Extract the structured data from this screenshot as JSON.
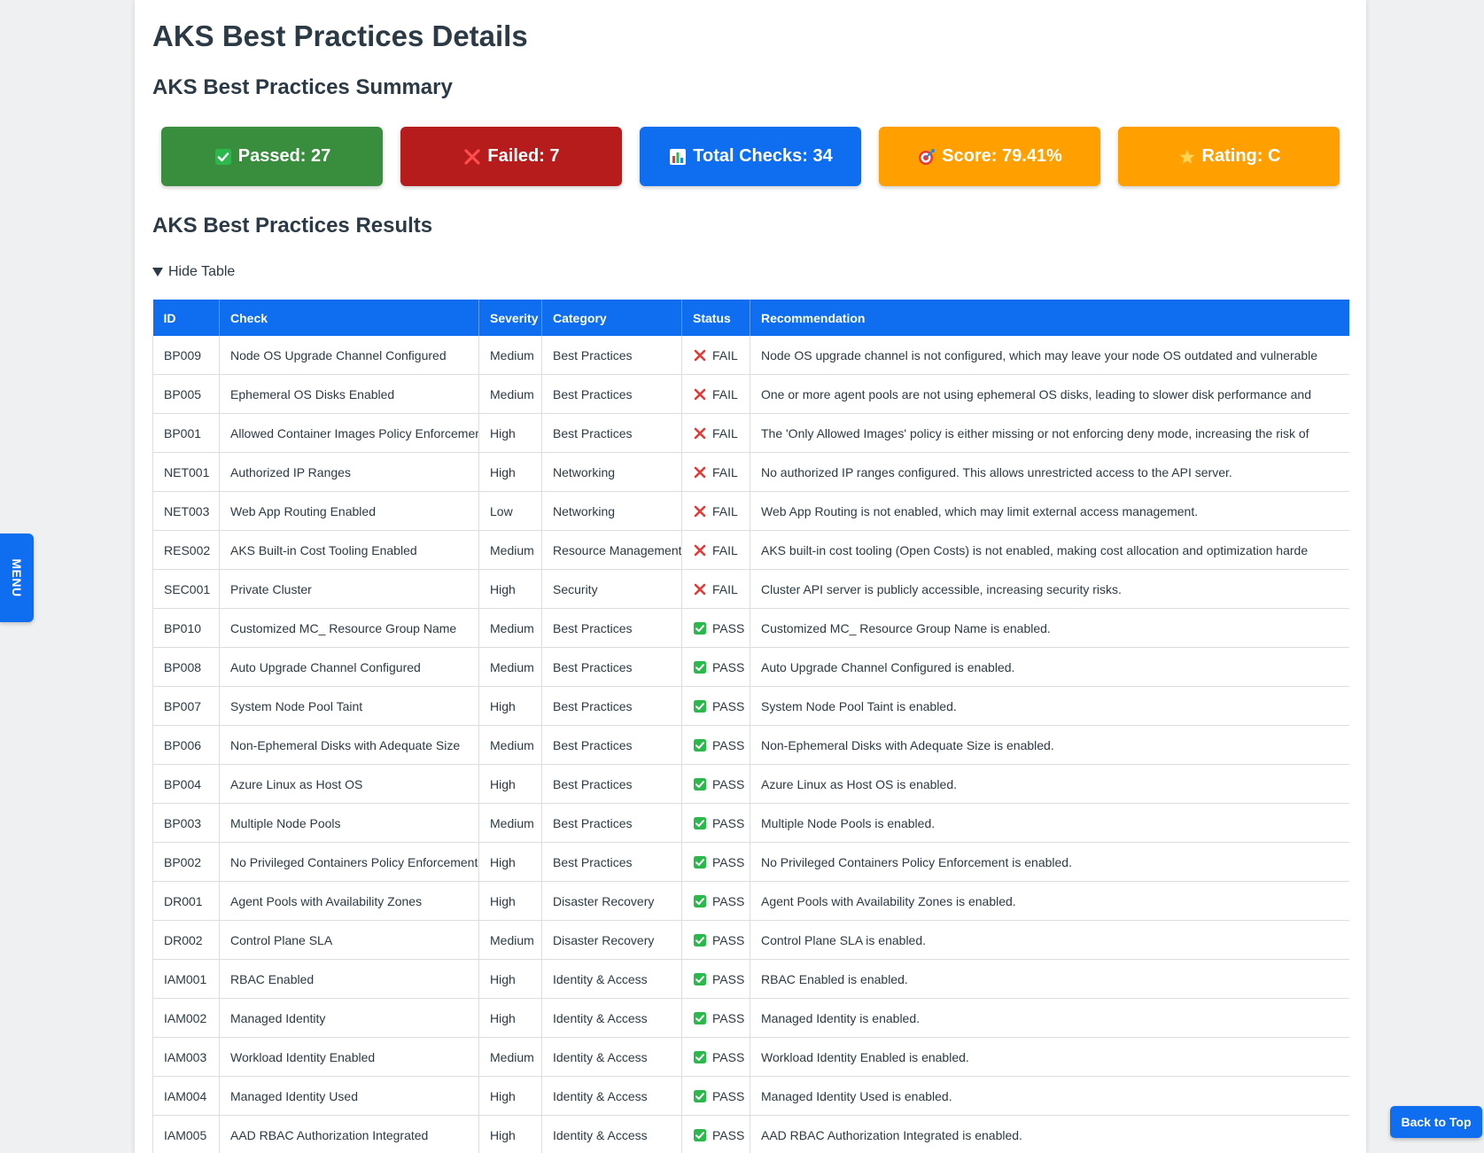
{
  "page": {
    "title": "AKS Best Practices Details",
    "summary_heading": "AKS Best Practices Summary",
    "results_heading": "AKS Best Practices Results",
    "toggle_label": "Hide Table"
  },
  "summary": {
    "passed": {
      "label": "Passed: 27",
      "icon": "check-box-icon",
      "color": "#388e3c"
    },
    "failed": {
      "label": "Failed: 7",
      "icon": "cross-icon",
      "color": "#b71c1c"
    },
    "total": {
      "label": "Total Checks: 34",
      "icon": "bar-chart-icon",
      "color": "#0f6ef0"
    },
    "score": {
      "label": "Score: 79.41%",
      "icon": "target-icon",
      "color": "#ffa000"
    },
    "rating": {
      "label": "Rating: C",
      "icon": "star-icon",
      "color": "#ffa000"
    }
  },
  "table": {
    "headers": [
      "ID",
      "Check",
      "Severity",
      "Category",
      "Status",
      "Recommendation"
    ],
    "rows": [
      {
        "id": "BP009",
        "check": "Node OS Upgrade Channel Configured",
        "severity": "Medium",
        "category": "Best Practices",
        "status": "FAIL",
        "recommendation": "Node OS upgrade channel is not configured, which may leave your node OS outdated and vulnerable"
      },
      {
        "id": "BP005",
        "check": "Ephemeral OS Disks Enabled",
        "severity": "Medium",
        "category": "Best Practices",
        "status": "FAIL",
        "recommendation": "One or more agent pools are not using ephemeral OS disks, leading to slower disk performance and"
      },
      {
        "id": "BP001",
        "check": "Allowed Container Images Policy Enforcement",
        "severity": "High",
        "category": "Best Practices",
        "status": "FAIL",
        "recommendation": "The 'Only Allowed Images' policy is either missing or not enforcing deny mode, increasing the risk of"
      },
      {
        "id": "NET001",
        "check": "Authorized IP Ranges",
        "severity": "High",
        "category": "Networking",
        "status": "FAIL",
        "recommendation": "No authorized IP ranges configured. This allows unrestricted access to the API server."
      },
      {
        "id": "NET003",
        "check": "Web App Routing Enabled",
        "severity": "Low",
        "category": "Networking",
        "status": "FAIL",
        "recommendation": "Web App Routing is not enabled, which may limit external access management."
      },
      {
        "id": "RES002",
        "check": "AKS Built-in Cost Tooling Enabled",
        "severity": "Medium",
        "category": "Resource Management",
        "status": "FAIL",
        "recommendation": "AKS built-in cost tooling (Open Costs) is not enabled, making cost allocation and optimization harde"
      },
      {
        "id": "SEC001",
        "check": "Private Cluster",
        "severity": "High",
        "category": "Security",
        "status": "FAIL",
        "recommendation": "Cluster API server is publicly accessible, increasing security risks."
      },
      {
        "id": "BP010",
        "check": "Customized MC_ Resource Group Name",
        "severity": "Medium",
        "category": "Best Practices",
        "status": "PASS",
        "recommendation": "Customized MC_ Resource Group Name is enabled."
      },
      {
        "id": "BP008",
        "check": "Auto Upgrade Channel Configured",
        "severity": "Medium",
        "category": "Best Practices",
        "status": "PASS",
        "recommendation": "Auto Upgrade Channel Configured is enabled."
      },
      {
        "id": "BP007",
        "check": "System Node Pool Taint",
        "severity": "High",
        "category": "Best Practices",
        "status": "PASS",
        "recommendation": "System Node Pool Taint is enabled."
      },
      {
        "id": "BP006",
        "check": "Non-Ephemeral Disks with Adequate Size",
        "severity": "Medium",
        "category": "Best Practices",
        "status": "PASS",
        "recommendation": "Non-Ephemeral Disks with Adequate Size is enabled."
      },
      {
        "id": "BP004",
        "check": "Azure Linux as Host OS",
        "severity": "High",
        "category": "Best Practices",
        "status": "PASS",
        "recommendation": "Azure Linux as Host OS is enabled."
      },
      {
        "id": "BP003",
        "check": "Multiple Node Pools",
        "severity": "Medium",
        "category": "Best Practices",
        "status": "PASS",
        "recommendation": "Multiple Node Pools is enabled."
      },
      {
        "id": "BP002",
        "check": "No Privileged Containers Policy Enforcement",
        "severity": "High",
        "category": "Best Practices",
        "status": "PASS",
        "recommendation": "No Privileged Containers Policy Enforcement is enabled."
      },
      {
        "id": "DR001",
        "check": "Agent Pools with Availability Zones",
        "severity": "High",
        "category": "Disaster Recovery",
        "status": "PASS",
        "recommendation": "Agent Pools with Availability Zones is enabled."
      },
      {
        "id": "DR002",
        "check": "Control Plane SLA",
        "severity": "Medium",
        "category": "Disaster Recovery",
        "status": "PASS",
        "recommendation": "Control Plane SLA is enabled."
      },
      {
        "id": "IAM001",
        "check": "RBAC Enabled",
        "severity": "High",
        "category": "Identity & Access",
        "status": "PASS",
        "recommendation": "RBAC Enabled is enabled."
      },
      {
        "id": "IAM002",
        "check": "Managed Identity",
        "severity": "High",
        "category": "Identity & Access",
        "status": "PASS",
        "recommendation": "Managed Identity is enabled."
      },
      {
        "id": "IAM003",
        "check": "Workload Identity Enabled",
        "severity": "Medium",
        "category": "Identity & Access",
        "status": "PASS",
        "recommendation": "Workload Identity Enabled is enabled."
      },
      {
        "id": "IAM004",
        "check": "Managed Identity Used",
        "severity": "High",
        "category": "Identity & Access",
        "status": "PASS",
        "recommendation": "Managed Identity Used is enabled."
      },
      {
        "id": "IAM005",
        "check": "AAD RBAC Authorization Integrated",
        "severity": "High",
        "category": "Identity & Access",
        "status": "PASS",
        "recommendation": "AAD RBAC Authorization Integrated is enabled."
      }
    ]
  },
  "menu_tab": {
    "label": "MENU"
  },
  "back_to_top": {
    "label": "Back to Top"
  },
  "colors": {
    "accent": "#0f6ef0",
    "pass": "#2db84d",
    "fail": "#e53935"
  }
}
